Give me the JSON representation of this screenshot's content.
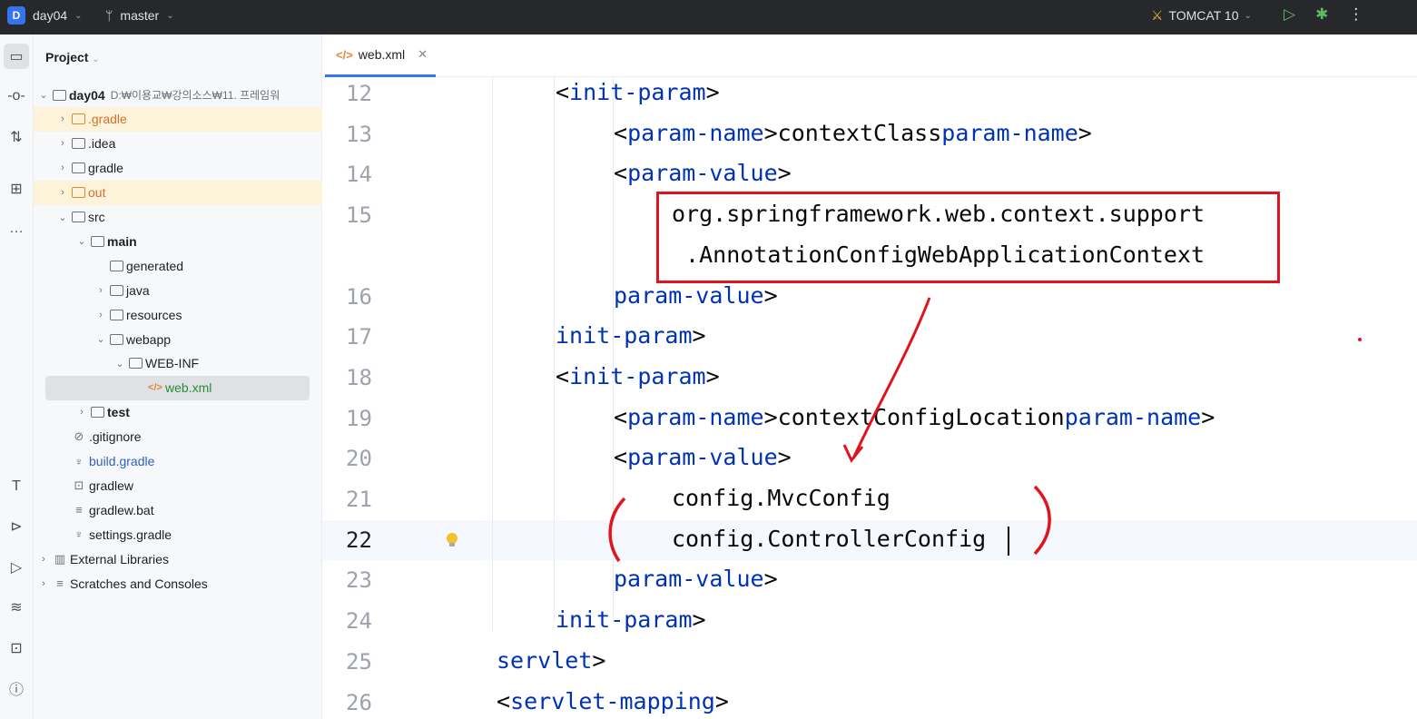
{
  "titlebar": {
    "project_badge": "D",
    "project_name": "day04",
    "branch_icon": "git-branch-icon",
    "branch": "master",
    "run_config": "TOMCAT 10"
  },
  "project_panel": {
    "title": "Project",
    "tree": [
      {
        "label": "day04",
        "path": "D:₩이용교₩강의소스₩11. 프레임워",
        "expander": "open",
        "icon": "module",
        "bold": true,
        "style": "plain"
      },
      {
        "label": ".gradle",
        "expander": "closed",
        "icon": "folder",
        "style": "orange",
        "highlight": true
      },
      {
        "label": ".idea",
        "expander": "closed",
        "icon": "folder",
        "style": "plain"
      },
      {
        "label": "gradle",
        "expander": "closed",
        "icon": "folder",
        "style": "plain"
      },
      {
        "label": "out",
        "expander": "closed",
        "icon": "folder",
        "style": "orange",
        "highlight": true
      },
      {
        "label": "src",
        "expander": "open",
        "icon": "folder",
        "style": "plain"
      },
      {
        "label": "main",
        "expander": "open",
        "icon": "folder",
        "bold": true,
        "style": "plain"
      },
      {
        "label": "generated",
        "expander": "none",
        "icon": "folder",
        "style": "plain"
      },
      {
        "label": "java",
        "expander": "closed",
        "icon": "folder",
        "style": "plain"
      },
      {
        "label": "resources",
        "expander": "closed",
        "icon": "folder",
        "style": "plain"
      },
      {
        "label": "webapp",
        "expander": "open",
        "icon": "folder",
        "style": "plain"
      },
      {
        "label": "WEB-INF",
        "expander": "open",
        "icon": "folder",
        "style": "plain"
      },
      {
        "label": "web.xml",
        "expander": "none",
        "icon": "xml",
        "style": "green",
        "selected": true
      },
      {
        "label": "test",
        "expander": "closed",
        "icon": "folder",
        "bold": true,
        "style": "plain"
      },
      {
        "label": ".gitignore",
        "expander": "none",
        "icon": "ignore",
        "style": "plain"
      },
      {
        "label": "build.gradle",
        "expander": "none",
        "icon": "gradle",
        "style": "blue"
      },
      {
        "label": "gradlew",
        "expander": "none",
        "icon": "terminal",
        "style": "plain"
      },
      {
        "label": "gradlew.bat",
        "expander": "none",
        "icon": "text",
        "style": "plain"
      },
      {
        "label": "settings.gradle",
        "expander": "none",
        "icon": "gradle",
        "style": "plain"
      },
      {
        "label": "External Libraries",
        "expander": "closed",
        "icon": "library",
        "style": "plain"
      },
      {
        "label": "Scratches and Consoles",
        "expander": "closed",
        "icon": "scratch",
        "style": "plain"
      }
    ]
  },
  "editor": {
    "tab_label": "web.xml",
    "current_line": "22",
    "lines": [
      {
        "num": "12",
        "indent": 2,
        "parts": [
          [
            "t",
            "<init-param>"
          ]
        ]
      },
      {
        "num": "13",
        "indent": 3,
        "parts": [
          [
            "t",
            "<param-name>"
          ],
          [
            "x",
            "contextClass"
          ],
          [
            "t",
            "</param-name>"
          ]
        ]
      },
      {
        "num": "14",
        "indent": 3,
        "parts": [
          [
            "t",
            "<param-value>"
          ]
        ]
      },
      {
        "num": "15",
        "indent": 4,
        "parts": [
          [
            "x",
            "org.springframework.web.context.support"
          ]
        ]
      },
      {
        "num": "",
        "indent": 4,
        "parts": [
          [
            "x",
            " .AnnotationConfigWebApplicationContext"
          ]
        ]
      },
      {
        "num": "16",
        "indent": 3,
        "parts": [
          [
            "t",
            "</param-value>"
          ]
        ]
      },
      {
        "num": "17",
        "indent": 2,
        "parts": [
          [
            "t",
            "</init-param>"
          ]
        ]
      },
      {
        "num": "18",
        "indent": 2,
        "parts": [
          [
            "t",
            "<init-param>"
          ]
        ]
      },
      {
        "num": "19",
        "indent": 3,
        "parts": [
          [
            "t",
            "<param-name>"
          ],
          [
            "x",
            "contextConfigLocation"
          ],
          [
            "t",
            "</param-name>"
          ]
        ]
      },
      {
        "num": "20",
        "indent": 3,
        "parts": [
          [
            "t",
            "<param-value>"
          ]
        ]
      },
      {
        "num": "21",
        "indent": 4,
        "parts": [
          [
            "x",
            "config.MvcConfig"
          ]
        ]
      },
      {
        "num": "22",
        "indent": 4,
        "parts": [
          [
            "x",
            "config.ControllerConfig"
          ]
        ]
      },
      {
        "num": "23",
        "indent": 3,
        "parts": [
          [
            "t",
            "</param-value>"
          ]
        ]
      },
      {
        "num": "24",
        "indent": 2,
        "parts": [
          [
            "t",
            "</init-param>"
          ]
        ]
      },
      {
        "num": "25",
        "indent": 1,
        "parts": [
          [
            "t",
            "</servlet>"
          ]
        ]
      },
      {
        "num": "26",
        "indent": 1,
        "parts": [
          [
            "t",
            "<servlet-mapping>"
          ]
        ]
      }
    ]
  },
  "annotation_color": "#e0141e"
}
